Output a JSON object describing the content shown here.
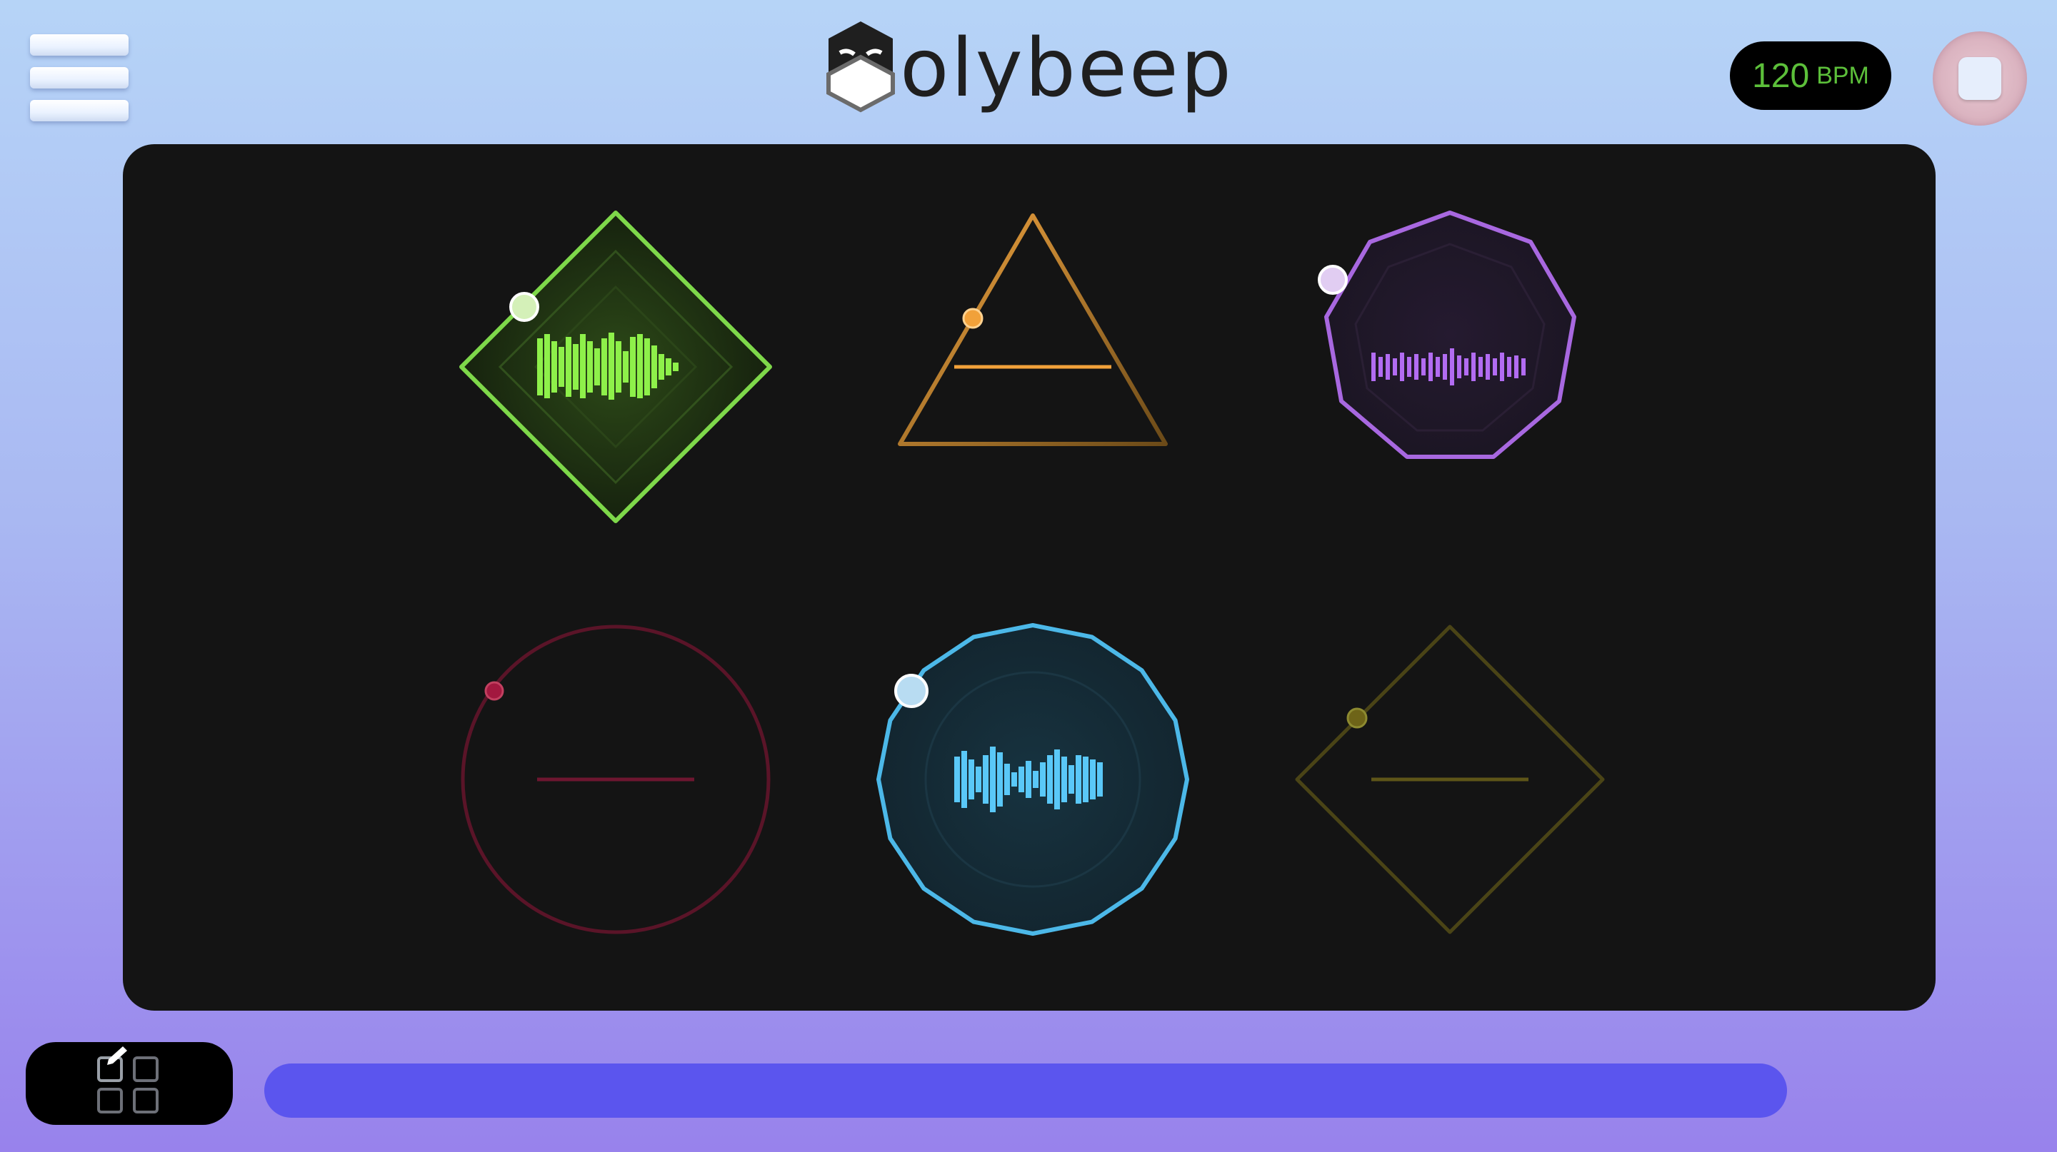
{
  "app": {
    "logo_text": "olybeep"
  },
  "header": {
    "bpm_value": "120",
    "bpm_unit": "BPM",
    "menu_icon": "hamburger-icon",
    "stop_icon": "stop-icon"
  },
  "colors": {
    "background_top": "#b6d4f7",
    "background_bottom": "#9882ec",
    "stage": "#141414",
    "bpm_text": "#5cbf3a",
    "progress": "#5b55ee"
  },
  "tracks": [
    {
      "shape": "diamond",
      "sides": 4,
      "color": "#8ef04a",
      "active": true,
      "has_waveform": true
    },
    {
      "shape": "triangle",
      "sides": 3,
      "color": "#f1a13a",
      "active": true,
      "has_waveform": false
    },
    {
      "shape": "nonagon",
      "sides": 9,
      "color": "#a868e0",
      "active": true,
      "has_waveform": true
    },
    {
      "shape": "circle",
      "sides": 0,
      "color": "#6e1630",
      "active": false,
      "has_waveform": false
    },
    {
      "shape": "polygon",
      "sides": 16,
      "color": "#4cb8e8",
      "active": true,
      "has_waveform": true
    },
    {
      "shape": "diamond",
      "sides": 4,
      "color": "#5e5518",
      "active": false,
      "has_waveform": false
    }
  ],
  "footer": {
    "edit_icon": "edit-grid-icon",
    "progress": 1.0
  }
}
